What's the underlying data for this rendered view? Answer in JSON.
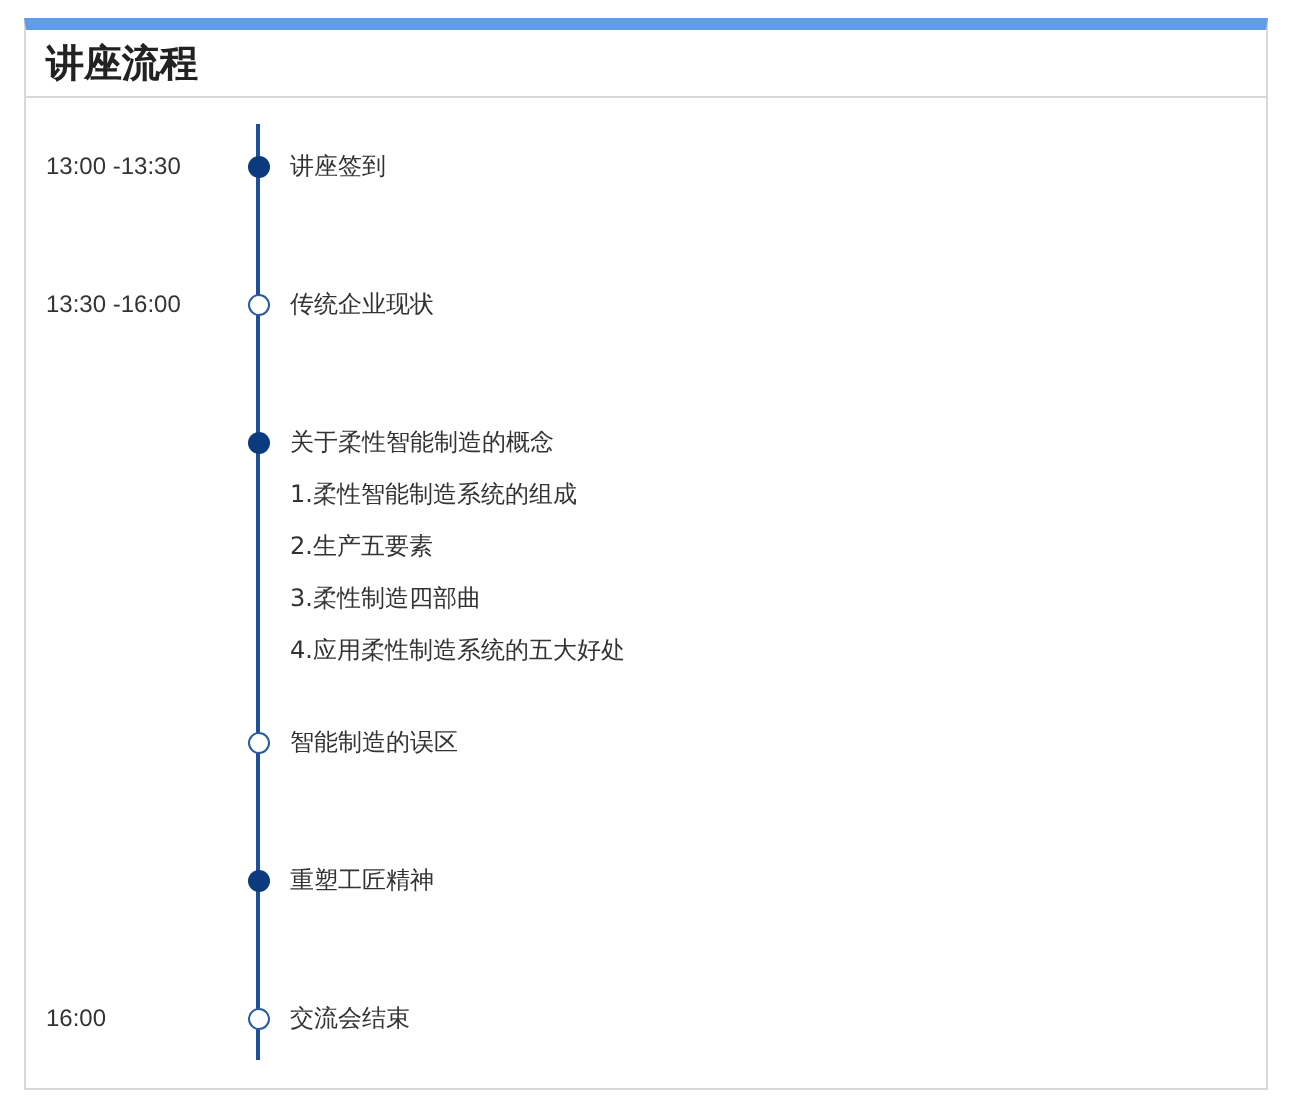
{
  "title": "讲座流程",
  "schedule": [
    {
      "time": "13:00 -13:30",
      "filled": true,
      "title": "讲座签到"
    },
    {
      "time": "13:30 -16:00",
      "filled": false,
      "title": "传统企业现状"
    },
    {
      "filled": true,
      "title": "关于柔性智能制造的概念",
      "details": [
        "1.柔性智能制造系统的组成",
        "2.生产五要素",
        "3.柔性制造四部曲",
        "4.应用柔性制造系统的五大好处"
      ]
    },
    {
      "filled": false,
      "title": "智能制造的误区"
    },
    {
      "filled": true,
      "title": "重塑工匠精神"
    },
    {
      "time": "16:00",
      "filled": false,
      "title": "交流会结束"
    }
  ]
}
